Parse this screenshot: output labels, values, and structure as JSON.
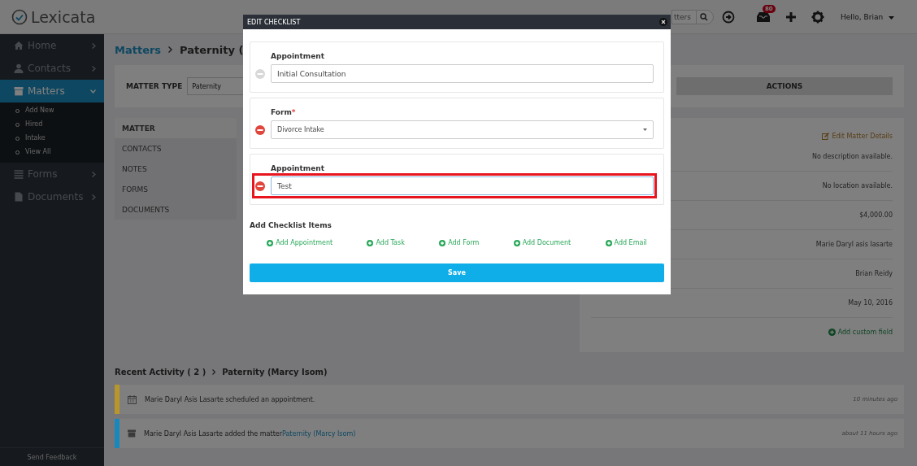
{
  "app": {
    "logo": "Lexicata"
  },
  "topbar": {
    "search_placeholder": "tters",
    "notification_count": "80",
    "user": "Hello, Brian"
  },
  "sidebar": {
    "items": [
      {
        "label": "Home",
        "selected": false,
        "expanded": false
      },
      {
        "label": "Contacts",
        "selected": false,
        "expanded": false
      },
      {
        "label": "Matters",
        "selected": true,
        "expanded": true,
        "children": [
          {
            "label": "Add New"
          },
          {
            "label": "Hired"
          },
          {
            "label": "Intake"
          },
          {
            "label": "View All"
          }
        ]
      },
      {
        "label": "Forms",
        "selected": false,
        "expanded": false
      },
      {
        "label": "Documents",
        "selected": false,
        "expanded": false
      }
    ],
    "footer": "Send Feedback"
  },
  "breadcrumb": {
    "root": "Matters",
    "current": "Paternity ("
  },
  "matter_type": {
    "label": "MATTER TYPE",
    "value": "Paternity"
  },
  "actions_button": "ACTIONS",
  "matter_tabs": [
    {
      "label": "MATTER",
      "selected": true
    },
    {
      "label": "CONTACTS",
      "selected": false
    },
    {
      "label": "NOTES",
      "selected": false
    },
    {
      "label": "FORMS",
      "selected": false
    },
    {
      "label": "DOCUMENTS",
      "selected": false
    }
  ],
  "details": {
    "edit_link": "Edit Matter Details",
    "values": [
      "No description available.",
      "No location available.",
      "$4,000.00",
      "Marie Daryl asis lasarte",
      "Brian Reidy",
      "May 10, 2016"
    ],
    "add_field": "Add custom field"
  },
  "recent_activity": {
    "title": "Recent Activity ( 2 )",
    "matter": "Paternity (Marcy Isom)",
    "items": [
      {
        "kind": "calendar",
        "color": "#b8962a",
        "text": "Marie Daryl Asis Lasarte scheduled an appointment.",
        "time": "10 minutes ago"
      },
      {
        "kind": "matter",
        "color": "#1788bb",
        "text": "Marie Daryl Asis Lasarte added the matter",
        "link": "Paternity (Marcy Isom)",
        "time": "about 11 hours ago"
      }
    ]
  },
  "modal": {
    "title": "EDIT CHECKLIST",
    "items": [
      {
        "kind": "input",
        "label": "Appointment",
        "value": "Initial Consultation",
        "removable": false,
        "highlighted": false
      },
      {
        "kind": "select",
        "label": "Form",
        "required_mark": "*",
        "value": "Divorce Intake",
        "removable": true,
        "highlighted": false
      },
      {
        "kind": "input",
        "label": "Appointment",
        "value": "Test",
        "removable": true,
        "highlighted": true
      }
    ],
    "add_title": "Add Checklist Items",
    "add_links": [
      "Add Appointment",
      "Add Task",
      "Add Form",
      "Add Document",
      "Add Email"
    ],
    "save": "Save"
  }
}
